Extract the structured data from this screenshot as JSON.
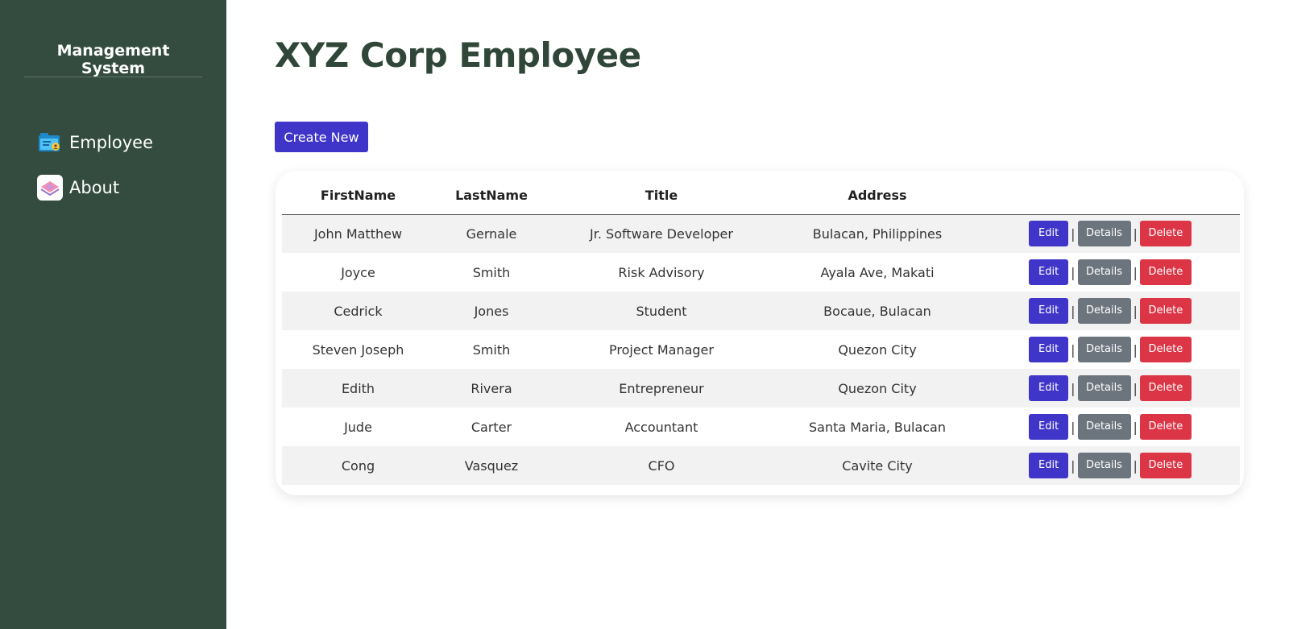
{
  "sidebar": {
    "brand": "Management System",
    "items": [
      {
        "label": "Employee",
        "icon": "employee-folder-icon"
      },
      {
        "label": "About",
        "icon": "about-layers-icon"
      }
    ]
  },
  "main": {
    "title": "XYZ Corp Employee",
    "create_label": "Create New",
    "table": {
      "headers": [
        "FirstName",
        "LastName",
        "Title",
        "Address",
        ""
      ],
      "rows": [
        [
          "John Matthew",
          "Gernale",
          "Jr. Software Developer",
          "Bulacan, Philippines"
        ],
        [
          "Joyce",
          "Smith",
          "Risk Advisory",
          "Ayala Ave, Makati"
        ],
        [
          "Cedrick",
          "Jones",
          "Student",
          "Bocaue, Bulacan"
        ],
        [
          "Steven Joseph",
          "Smith",
          "Project Manager",
          "Quezon City"
        ],
        [
          "Edith",
          "Rivera",
          "Entrepreneur",
          "Quezon City"
        ],
        [
          "Jude",
          "Carter",
          "Accountant",
          "Santa Maria, Bulacan"
        ],
        [
          "Cong",
          "Vasquez",
          "CFO",
          "Cavite City"
        ]
      ],
      "actions": {
        "edit": "Edit",
        "details": "Details",
        "delete": "Delete",
        "separator": "|"
      }
    }
  },
  "colors": {
    "sidebar_bg": "#344c40",
    "primary": "#4035c9",
    "secondary": "#6c757d",
    "danger": "#dc3545",
    "title": "#2f4638"
  }
}
